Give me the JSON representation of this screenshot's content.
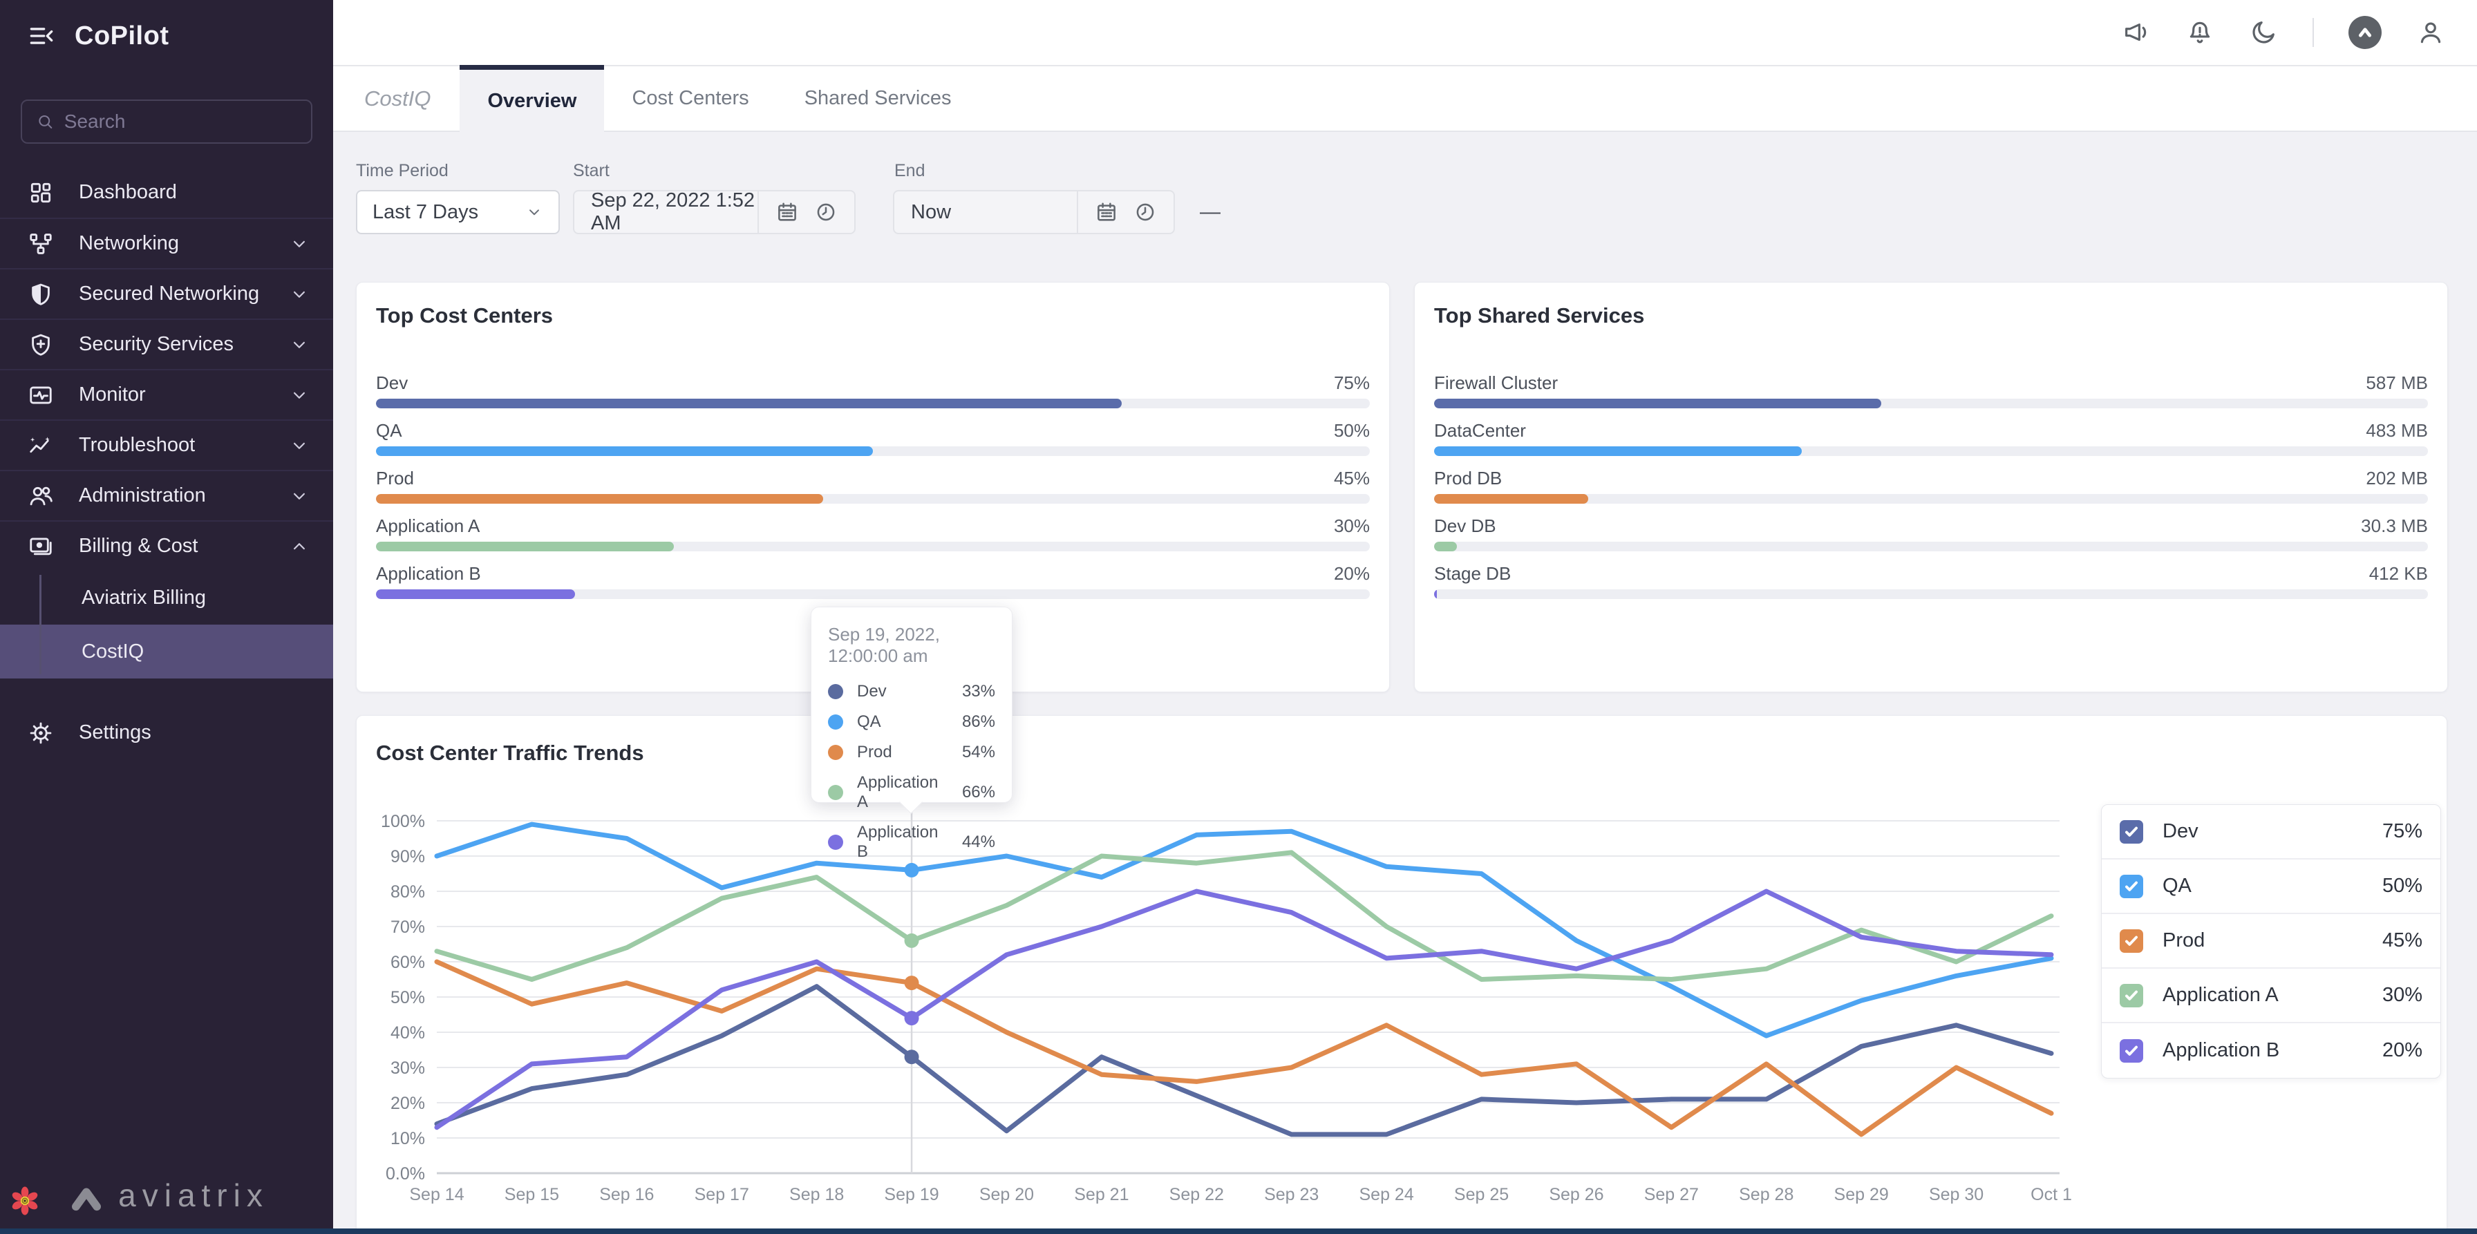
{
  "sidebar": {
    "brand": "CoPilot",
    "search_placeholder": "Search",
    "items": [
      {
        "label": "Dashboard",
        "icon": "dashboard"
      },
      {
        "label": "Networking",
        "icon": "networking",
        "chevron": "down"
      },
      {
        "label": "Secured Networking",
        "icon": "shield-half",
        "chevron": "down"
      },
      {
        "label": "Security Services",
        "icon": "shield-plus",
        "chevron": "down"
      },
      {
        "label": "Monitor",
        "icon": "monitor",
        "chevron": "down"
      },
      {
        "label": "Troubleshoot",
        "icon": "trend",
        "chevron": "down"
      },
      {
        "label": "Administration",
        "icon": "users",
        "chevron": "down"
      },
      {
        "label": "Billing & Cost",
        "icon": "billing",
        "chevron": "up",
        "expanded": true,
        "children": [
          {
            "label": "Aviatrix Billing"
          },
          {
            "label": "CostIQ",
            "selected": true
          }
        ]
      }
    ],
    "settings": {
      "label": "Settings",
      "icon": "gear"
    },
    "footer_logo_text": "aviatrix"
  },
  "header": {
    "icon_names": [
      "megaphone",
      "bell",
      "moon",
      "avx-logo",
      "user"
    ]
  },
  "tabs": {
    "brand": "CostIQ",
    "items": [
      {
        "label": "Overview",
        "active": true
      },
      {
        "label": "Cost Centers"
      },
      {
        "label": "Shared Services"
      }
    ]
  },
  "filters": {
    "time_period_label": "Time Period",
    "time_period_value": "Last 7 Days",
    "start_label": "Start",
    "start_value": "Sep 22, 2022 1:52 AM",
    "range_separator": "—",
    "end_label": "End",
    "end_value": "Now"
  },
  "cost_centers_card": {
    "title": "Top Cost Centers",
    "rows": [
      {
        "label": "Dev",
        "value": "75%",
        "pct": 75,
        "color": "#5a6caa"
      },
      {
        "label": "QA",
        "value": "50%",
        "pct": 50,
        "color": "#4da4f2"
      },
      {
        "label": "Prod",
        "value": "45%",
        "pct": 45,
        "color": "#e08a4c"
      },
      {
        "label": "Application A",
        "value": "30%",
        "pct": 30,
        "color": "#9ccaa5"
      },
      {
        "label": "Application B",
        "value": "20%",
        "pct": 20,
        "color": "#7b70e0"
      }
    ]
  },
  "shared_services_card": {
    "title": "Top Shared Services",
    "rows": [
      {
        "label": "Firewall Cluster",
        "value": "587 MB",
        "pct": 45,
        "color": "#5a6caa"
      },
      {
        "label": "DataCenter",
        "value": "483 MB",
        "pct": 37,
        "color": "#4da4f2"
      },
      {
        "label": "Prod DB",
        "value": "202 MB",
        "pct": 15.5,
        "color": "#e08a4c"
      },
      {
        "label": "Dev DB",
        "value": "30.3 MB",
        "pct": 2.3,
        "color": "#9ccaa5"
      },
      {
        "label": "Stage DB",
        "value": "412 KB",
        "pct": 0.3,
        "color": "#7b70e0"
      }
    ]
  },
  "chart_card": {
    "title": "Cost Center Traffic Trends"
  },
  "chart_data": {
    "type": "line",
    "title": "Cost Center Traffic Trends",
    "x": [
      "Sep 14",
      "Sep 15",
      "Sep 16",
      "Sep 17",
      "Sep 18",
      "Sep 19",
      "Sep 20",
      "Sep 21",
      "Sep 22",
      "Sep 23",
      "Sep 24",
      "Sep 25",
      "Sep 26",
      "Sep 27",
      "Sep 28",
      "Sep 29",
      "Sep 30",
      "Oct 1"
    ],
    "ylim": [
      0,
      100
    ],
    "yticks": [
      "0.0%",
      "10%",
      "20%",
      "30%",
      "40%",
      "50%",
      "60%",
      "70%",
      "80%",
      "90%",
      "100%"
    ],
    "grid": true,
    "legend_position": "right",
    "series": [
      {
        "name": "Dev",
        "color": "#5a6b9f",
        "values": [
          14,
          24,
          28,
          39,
          53,
          33,
          12,
          33,
          22,
          11,
          11,
          21,
          20,
          21,
          21,
          36,
          42,
          34
        ]
      },
      {
        "name": "QA",
        "color": "#4da4f2",
        "values": [
          90,
          99,
          95,
          81,
          88,
          86,
          90,
          84,
          96,
          97,
          87,
          85,
          66,
          53,
          39,
          49,
          56,
          61
        ]
      },
      {
        "name": "Prod",
        "color": "#e08a4c",
        "values": [
          60,
          48,
          54,
          46,
          58,
          54,
          40,
          28,
          26,
          30,
          42,
          28,
          31,
          13,
          31,
          11,
          30,
          17
        ]
      },
      {
        "name": "Application A",
        "color": "#9ccaa5",
        "values": [
          63,
          55,
          64,
          78,
          84,
          66,
          76,
          90,
          88,
          91,
          70,
          55,
          56,
          55,
          58,
          69,
          60,
          73
        ]
      },
      {
        "name": "Application B",
        "color": "#7b70e0",
        "values": [
          13,
          31,
          33,
          52,
          60,
          44,
          62,
          70,
          80,
          74,
          61,
          63,
          58,
          66,
          80,
          67,
          63,
          62
        ]
      }
    ],
    "tooltip": {
      "title": "Sep 19, 2022, 12:00:00 am",
      "x_index": 5,
      "rows": [
        {
          "name": "Dev",
          "value": "33%"
        },
        {
          "name": "QA",
          "value": "86%"
        },
        {
          "name": "Prod",
          "value": "54%"
        },
        {
          "name": "Application A",
          "value": "66%"
        },
        {
          "name": "Application B",
          "value": "44%"
        }
      ]
    }
  },
  "legend": {
    "rows": [
      {
        "label": "Dev",
        "value": "75%",
        "checked": true,
        "color": "#5a6caa"
      },
      {
        "label": "QA",
        "value": "50%",
        "checked": true,
        "color": "#4da4f2"
      },
      {
        "label": "Prod",
        "value": "45%",
        "checked": true,
        "color": "#e08a4c"
      },
      {
        "label": "Application A",
        "value": "30%",
        "checked": true,
        "color": "#9ccaa5"
      },
      {
        "label": "Application B",
        "value": "20%",
        "checked": true,
        "color": "#7b70e0"
      }
    ]
  },
  "colors": {
    "sidebar_bg": "#292236",
    "sidebar_selected": "#564e79",
    "active_tab_border": "#272c45",
    "page_bg": "#f1f1f5",
    "bottom_strip": "#1c3a5e"
  }
}
